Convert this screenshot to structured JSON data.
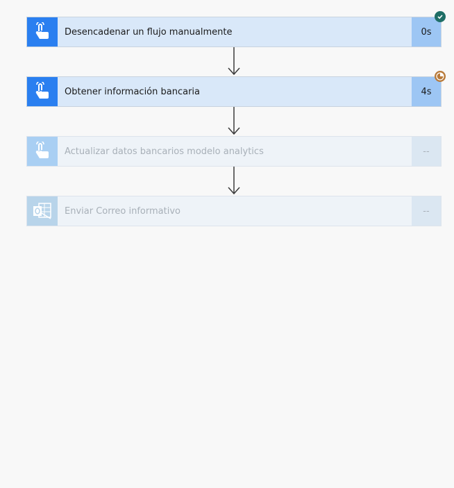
{
  "flow": {
    "steps": [
      {
        "title": "Desencadenar un flujo manualmente",
        "duration": "0s",
        "status": "succeeded",
        "icon": "manual-trigger-icon"
      },
      {
        "title": "Obtener información bancaria",
        "duration": "4s",
        "status": "running",
        "icon": "manual-trigger-icon"
      },
      {
        "title": "Actualizar datos bancarios modelo analytics",
        "duration": "--",
        "status": "pending",
        "icon": "manual-trigger-icon"
      },
      {
        "title": "Enviar Correo informativo",
        "duration": "--",
        "status": "pending",
        "icon": "outlook-icon"
      }
    ]
  },
  "colors": {
    "background": "#f8f8f8",
    "step_active_bg": "#d9e8f9",
    "icon_active_bg": "#2a7ff0",
    "duration_active_bg": "#9dc6f4",
    "success_badge": "#1f6e66",
    "running_badge": "#b87a3a",
    "arrow": "#3a3a3a"
  }
}
